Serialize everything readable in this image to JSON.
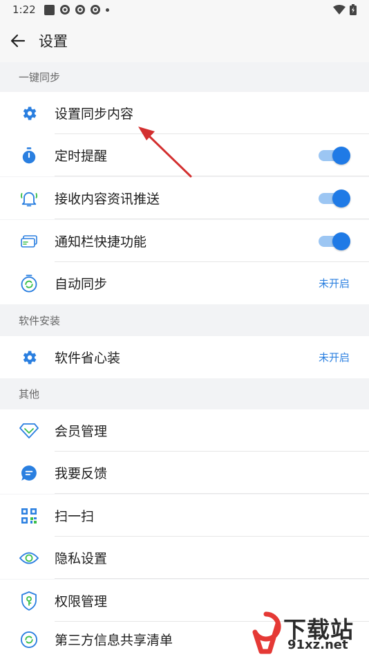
{
  "status_bar": {
    "time": "1:22"
  },
  "app_bar": {
    "title": "设置"
  },
  "sections": [
    {
      "header": "一键同步",
      "items": [
        {
          "label": "设置同步内容",
          "icon": "gear-icon"
        },
        {
          "label": "定时提醒",
          "icon": "stopwatch-icon",
          "toggle": true
        },
        {
          "label": "接收内容资讯推送",
          "icon": "bell-icon",
          "toggle": true
        },
        {
          "label": "通知栏快捷功能",
          "icon": "card-icon",
          "toggle": true
        },
        {
          "label": "自动同步",
          "icon": "sync-clock-icon",
          "value": "未开启"
        }
      ]
    },
    {
      "header": "软件安装",
      "items": [
        {
          "label": "软件省心装",
          "icon": "gear-icon",
          "value": "未开启"
        }
      ]
    },
    {
      "header": "其他",
      "items": [
        {
          "label": "会员管理",
          "icon": "diamond-icon"
        },
        {
          "label": "我要反馈",
          "icon": "chat-bubble-icon"
        },
        {
          "label": "扫一扫",
          "icon": "qr-code-icon"
        },
        {
          "label": "隐私设置",
          "icon": "eye-icon"
        },
        {
          "label": "权限管理",
          "icon": "shield-key-icon"
        },
        {
          "label": "第三方信息共享清单",
          "icon": "share-sync-icon"
        }
      ]
    }
  ],
  "watermark": {
    "brand": "下载站",
    "site": "91xz.net"
  },
  "colors": {
    "accent": "#1f7ae6",
    "toggle_track": "#9cc6f3",
    "link_value": "#2a7fe0",
    "annotation_arrow": "#d32f2f"
  }
}
